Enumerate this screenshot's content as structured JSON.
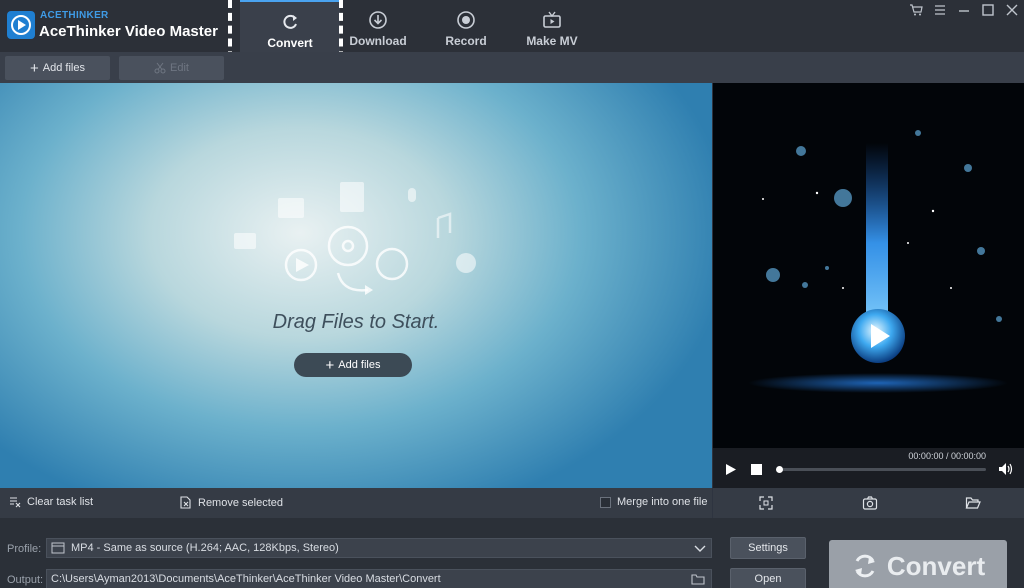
{
  "app": {
    "brand_small": "ACETHINKER",
    "title": "AceThinker Video Master"
  },
  "nav": {
    "tabs": [
      {
        "label": "Convert",
        "icon": "refresh-icon",
        "active": true
      },
      {
        "label": "Download",
        "icon": "download-icon",
        "active": false
      },
      {
        "label": "Record",
        "icon": "record-icon",
        "active": false
      },
      {
        "label": "Make MV",
        "icon": "tv-icon",
        "active": false
      }
    ]
  },
  "window_controls": [
    "cart-icon",
    "menu-icon",
    "minimize-icon",
    "maximize-icon",
    "close-icon"
  ],
  "toolbar": {
    "add_files": "Add files",
    "edit": "Edit"
  },
  "droparea": {
    "prompt": "Drag Files to Start.",
    "add_files": "Add files"
  },
  "player": {
    "time": "00:00:00 / 00:00:00",
    "progress": 0
  },
  "tasks": {
    "clear": "Clear task list",
    "remove": "Remove selected",
    "merge": "Merge into one file",
    "merge_checked": false
  },
  "settings": {
    "profile_label": "Profile:",
    "profile_value": "MP4 - Same as source (H.264; AAC, 128Kbps, Stereo)",
    "output_label": "Output:",
    "output_value": "C:\\Users\\Ayman2013\\Documents\\AceThinker\\AceThinker Video Master\\Convert",
    "settings_button": "Settings",
    "open_button": "Open",
    "convert_button": "Convert"
  },
  "colors": {
    "accent": "#4aa3f0",
    "brand": "#1f7fd1",
    "background": "#2e3440"
  }
}
